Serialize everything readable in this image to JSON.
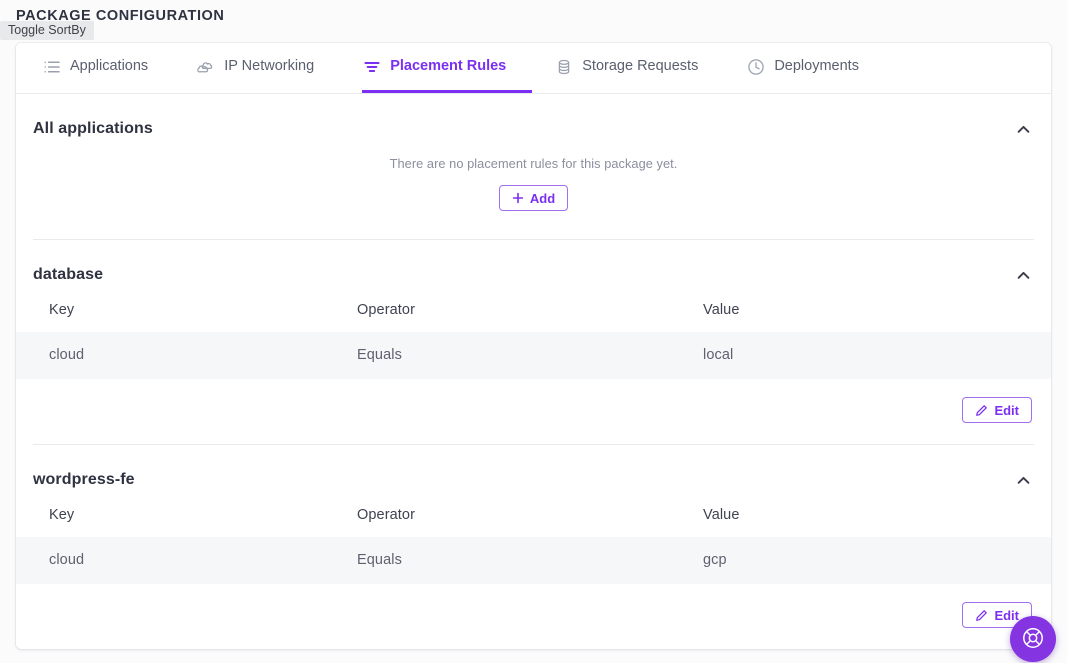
{
  "header": {
    "title": "PACKAGE CONFIGURATION"
  },
  "tooltip": {
    "text": "Toggle SortBy"
  },
  "tabs": [
    {
      "label": "Applications",
      "icon": "list-icon",
      "active": false
    },
    {
      "label": "IP Networking",
      "icon": "clouds-icon",
      "active": false
    },
    {
      "label": "Placement Rules",
      "icon": "filter-icon",
      "active": true
    },
    {
      "label": "Storage Requests",
      "icon": "database-icon",
      "active": false
    },
    {
      "label": "Deployments",
      "icon": "clock-icon",
      "active": false
    }
  ],
  "sections": [
    {
      "title": "All applications",
      "collapse_icon": "chevron-up-icon",
      "empty": true,
      "empty_text": "There are no placement rules for this package yet.",
      "add_label": "Add"
    },
    {
      "title": "database",
      "collapse_icon": "chevron-up-icon",
      "empty": false,
      "columns": [
        "Key",
        "Operator",
        "Value"
      ],
      "rows": [
        {
          "key": "cloud",
          "operator": "Equals",
          "value": "local"
        }
      ],
      "edit_label": "Edit"
    },
    {
      "title": "wordpress-fe",
      "collapse_icon": "chevron-up-icon",
      "empty": false,
      "columns": [
        "Key",
        "Operator",
        "Value"
      ],
      "rows": [
        {
          "key": "cloud",
          "operator": "Equals",
          "value": "gcp"
        }
      ],
      "edit_label": "Edit"
    }
  ],
  "fab": {
    "icon": "lifering-support-icon"
  },
  "colors": {
    "accent": "#7b2ff2",
    "fab_background": "#8434e0",
    "page_background": "#fbfbfc",
    "card_background": "#ffffff",
    "row_background": "#f6f7f9",
    "text_primary": "#2f3241",
    "text_secondary": "#5d6170",
    "divider": "#e9eaee"
  }
}
